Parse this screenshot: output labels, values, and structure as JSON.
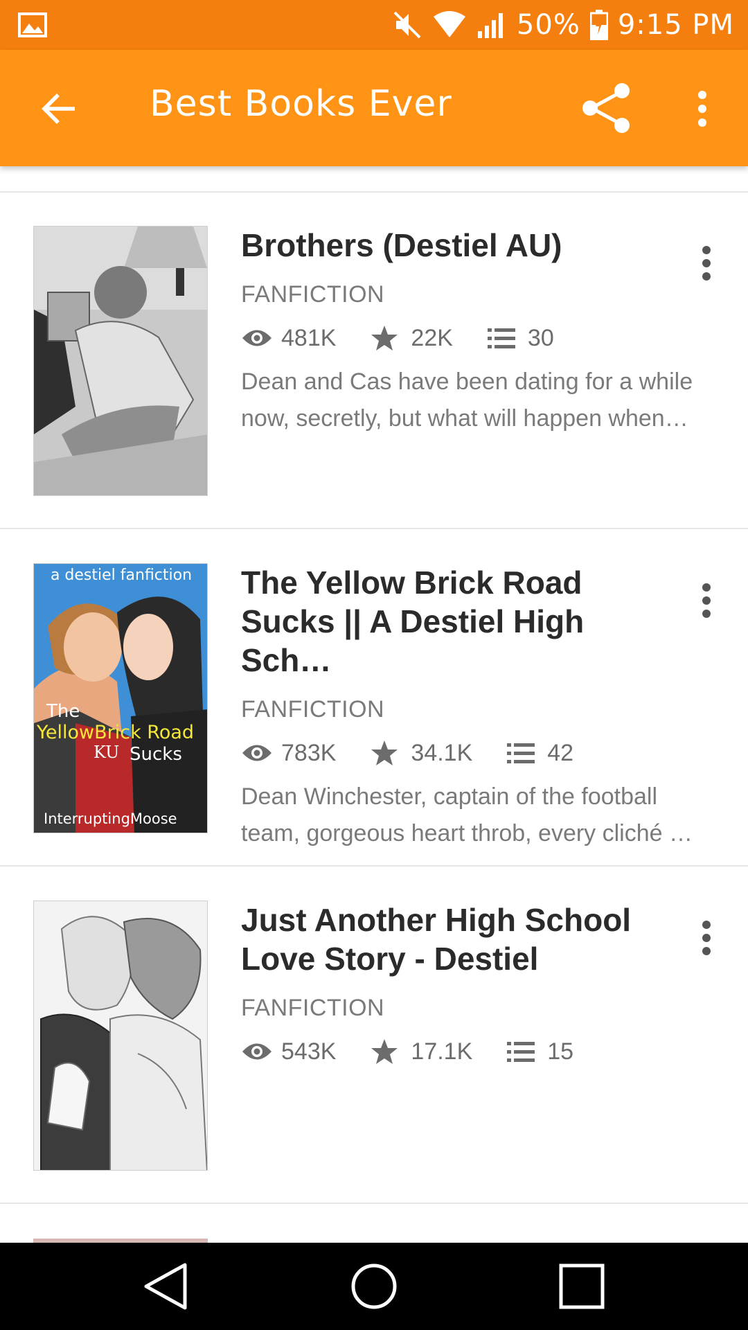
{
  "status_bar": {
    "battery": "50%",
    "time": "9:15 PM",
    "icons": [
      "image-icon",
      "mute-icon",
      "wifi-icon",
      "signal-icon",
      "battery-icon"
    ]
  },
  "app_bar": {
    "title": "Best Books Ever",
    "icons": [
      "back-arrow-icon",
      "share-icon",
      "more-vertical-icon"
    ]
  },
  "stories": [
    {
      "title": "Brothers (Destiel AU)",
      "category": "FANFICTION",
      "reads": "481K",
      "votes": "22K",
      "parts": "30",
      "desc_line1": "Dean and Cas have been dating for a while",
      "desc_line2": "now, secretly,  but what will happen when…"
    },
    {
      "title": "The Yellow Brick Road Sucks || A Destiel High Sch…",
      "category": "FANFICTION",
      "reads": "783K",
      "votes": "34.1K",
      "parts": "42",
      "desc_line1": "Dean Winchester, captain of the football",
      "desc_line2": "team, gorgeous heart throb,  every cliché …",
      "cover_text": {
        "top": "a destiel fanfiction",
        "the": "The",
        "yellow": "YellowBrick Road",
        "ku": "KU",
        "sucks": "Sucks",
        "author": "InterruptingMoose"
      }
    },
    {
      "title": "Just Another High School Love Story - Destiel",
      "category": "FANFICTION",
      "reads": "543K",
      "votes": "17.1K",
      "parts": "15",
      "desc_line1": "",
      "desc_line2": ""
    }
  ],
  "nav_bar": {
    "icons": [
      "back-triangle-icon",
      "home-circle-icon",
      "recents-square-icon"
    ]
  },
  "colors": {
    "status_bar": "#f47f0f",
    "app_bar": "#ff9316",
    "text_primary": "#2b2b2b",
    "text_secondary": "#7a7a7a"
  }
}
